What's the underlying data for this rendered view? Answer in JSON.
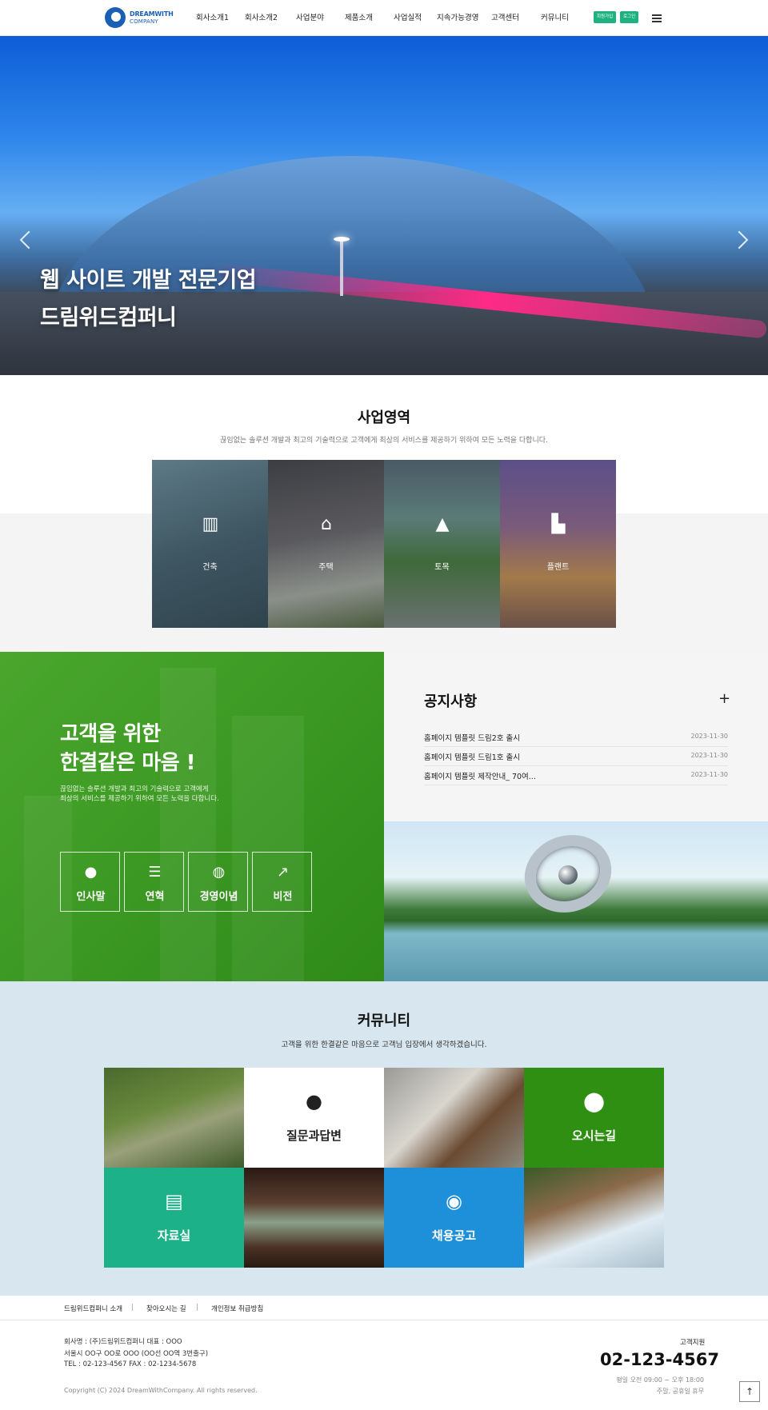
{
  "header": {
    "logo_line1": "DREAMWITH",
    "logo_line2": "COMPANY",
    "nav": [
      "회사소개1",
      "회사소개2",
      "사업분야",
      "제품소개",
      "사업실적",
      "지속가능경영",
      "고객센터",
      "커뮤니티"
    ],
    "signup_label": "회원가입",
    "login_label": "로그인"
  },
  "hero": {
    "line1": "웹 사이트 개발 전문기업",
    "line2": "드림위드컴퍼니"
  },
  "business": {
    "title": "사업영역",
    "subtitle": "끊임없는 솔루션 개발과 최고의 기술력으로 고객에게 최상의 서비스를 제공하기 위하여 모든 노력을 다합니다.",
    "tiles": [
      {
        "label": "건축",
        "icon": "building-icon"
      },
      {
        "label": "주택",
        "icon": "house-icon"
      },
      {
        "label": "토목",
        "icon": "road-icon"
      },
      {
        "label": "플랜트",
        "icon": "factory-icon"
      }
    ]
  },
  "promo": {
    "heading1": "고객을 위한",
    "heading2": "한결같은 마음 !",
    "desc1": "끊임없는 솔루션 개발과 최고의 기술력으로 고객에게",
    "desc2": "최상의 서비스를 제공하기 위하여 모든 노력을 다합니다.",
    "boxes": [
      {
        "label": "인사말",
        "icon": "user-icon"
      },
      {
        "label": "연혁",
        "icon": "list-icon"
      },
      {
        "label": "경영이념",
        "icon": "globe-icon"
      },
      {
        "label": "비전",
        "icon": "chart-icon"
      }
    ]
  },
  "notice": {
    "title": "공지사항",
    "more": "+",
    "items": [
      {
        "title": "홈페이지 템플릿 드림2호 출시",
        "date": "2023-11-30"
      },
      {
        "title": "홈페이지 템플릿 드림1호 출시",
        "date": "2023-11-30"
      },
      {
        "title": "홈페이지 템플릿 제작안내_ 70여...",
        "date": "2023-11-30"
      }
    ]
  },
  "community": {
    "title": "커뮤니티",
    "subtitle": "고객을 위한 한결같은 마음으로 고객님 입장에서 생각하겠습니다.",
    "qa_label": "질문과답변",
    "map_label": "오시는길",
    "data_label": "자료실",
    "jobs_label": "채용공고"
  },
  "footer": {
    "links": [
      "드림위드컴퍼니 소개",
      "찾아오시는 길",
      "개인정보 취급방침"
    ],
    "separator": "|",
    "company": "회사명 : (주)드림위드컴퍼니 대표 : OOO",
    "address": "서울시 OO구 OO로 OOO (OO선 OO역 3번출구)",
    "contact": "TEL : 02-123-4567 FAX : 02-1234-5678",
    "copyright": "Copyright (C) 2024 DreamWithCompany. All rights reserved.",
    "support_label": "고객지원",
    "phone": "02-123-4567",
    "hours1": "평일 오전 09:00 ~ 오후 18:00",
    "hours2": "주말, 공휴일 휴무",
    "top_button": "↑"
  },
  "colors": {
    "brand": "#1a5fb4",
    "accent_green": "#1db27f",
    "promo_green": "#3d9a24",
    "map_tile": "#2e8f12",
    "data_tile": "#1db18a",
    "jobs_tile": "#1e8fd9"
  }
}
